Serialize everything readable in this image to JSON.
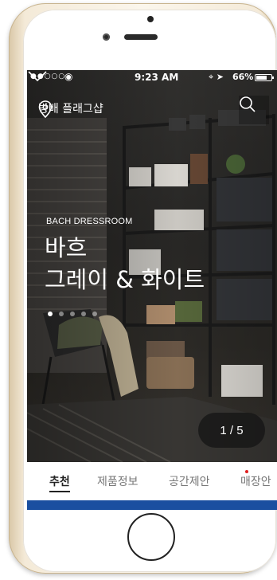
{
  "status_bar": {
    "carrier": "●●○○○",
    "time": "9:23 AM",
    "battery": "66%"
  },
  "header": {
    "location": "방배 플래그샵"
  },
  "hero": {
    "eyebrow": "BACH DRESSROOM",
    "title_line1": "바흐",
    "title_line2": "그레이 & 화이트",
    "pager": "1 / 5",
    "slide_count": 5,
    "active_slide": 1
  },
  "tabs": [
    {
      "label": "추천",
      "active": true
    },
    {
      "label": "제품정보",
      "active": false
    },
    {
      "label": "공간제안",
      "active": false,
      "badge": true
    },
    {
      "label": "매장안",
      "active": false
    }
  ],
  "colors": {
    "accent": "#1a4fa0",
    "badge": "#e02020"
  }
}
